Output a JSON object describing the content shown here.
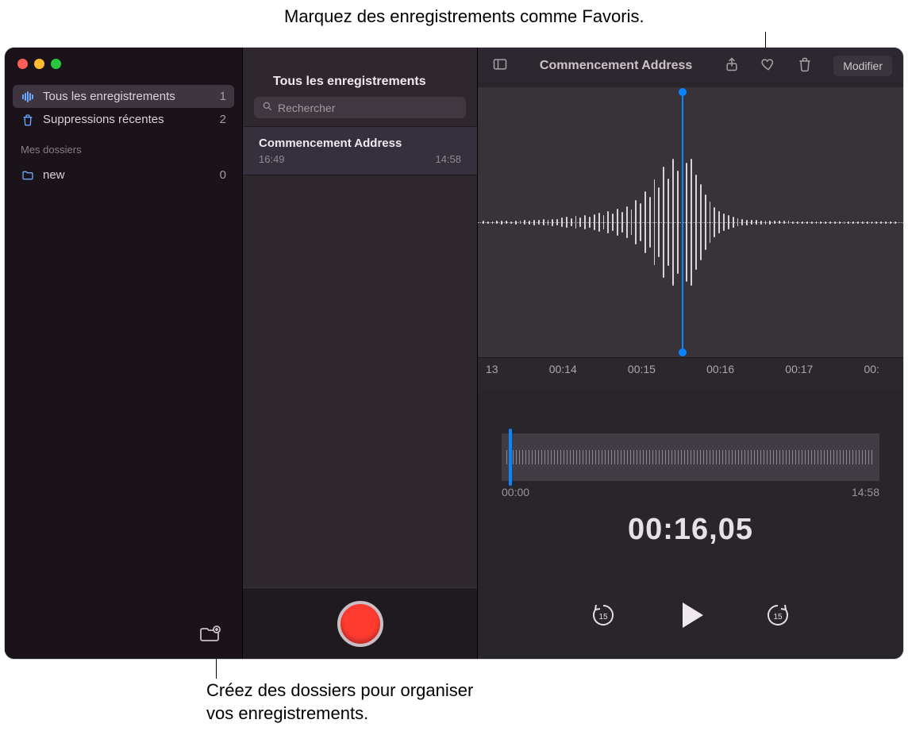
{
  "callouts": {
    "top": "Marquez des enregistrements comme Favoris.",
    "bottom_line1": "Créez des dossiers pour organiser",
    "bottom_line2": "vos enregistrements."
  },
  "sidebar": {
    "items": [
      {
        "label": "Tous les enregistrements",
        "count": "1",
        "icon": "waveform"
      },
      {
        "label": "Suppressions récentes",
        "count": "2",
        "icon": "trash"
      }
    ],
    "folders_heading": "Mes dossiers",
    "folders": [
      {
        "label": "new",
        "count": "0"
      }
    ]
  },
  "recordings_col": {
    "header": "Tous les enregistrements",
    "search_placeholder": "Rechercher",
    "items": [
      {
        "title": "Commencement Address",
        "time": "16:49",
        "duration": "14:58"
      }
    ]
  },
  "toolbar": {
    "title": "Commencement Address",
    "edit_label": "Modifier"
  },
  "ruler_ticks": [
    "13",
    "00:14",
    "00:15",
    "00:16",
    "00:17",
    "00:"
  ],
  "overview": {
    "start": "00:00",
    "end": "14:58"
  },
  "big_time": "00:16,05",
  "skip_seconds": "15",
  "waveform_heights": [
    4,
    3,
    3,
    4,
    5,
    4,
    3,
    5,
    4,
    6,
    5,
    7,
    6,
    8,
    7,
    9,
    8,
    12,
    14,
    10,
    16,
    12,
    18,
    14,
    20,
    24,
    18,
    28,
    22,
    34,
    26,
    40,
    32,
    56,
    48,
    78,
    64,
    108,
    88,
    140,
    110,
    160,
    130,
    172,
    150,
    160,
    120,
    96,
    70,
    52,
    38,
    28,
    22,
    18,
    14,
    10,
    8,
    7,
    6,
    6,
    5,
    5,
    5,
    4,
    4,
    4,
    4,
    3,
    3,
    3,
    3,
    3,
    3,
    3,
    3,
    3,
    3,
    3,
    3,
    3,
    3,
    3,
    3,
    3,
    3,
    3,
    3,
    3,
    3,
    3
  ]
}
